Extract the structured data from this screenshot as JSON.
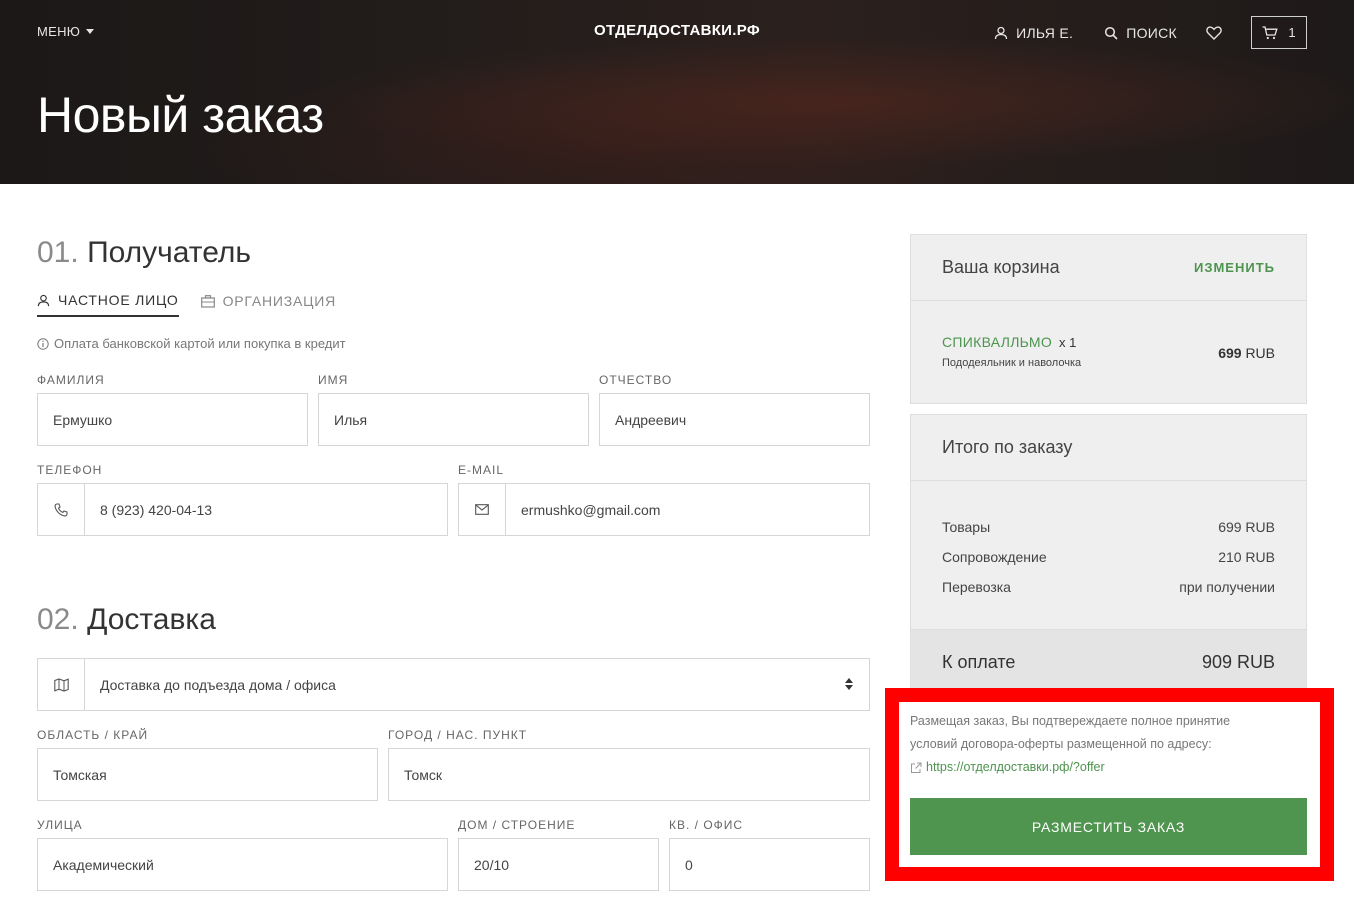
{
  "header": {
    "menu_label": "МЕНЮ",
    "brand": "ОТДЕЛДОСТАВКИ.РФ",
    "user_label": "ИЛЬЯ Е.",
    "search_label": "ПОИСК",
    "cart_count": "1",
    "page_title": "Новый заказ"
  },
  "recipient": {
    "num": "01.",
    "title": "Получатель",
    "tabs": [
      {
        "label": "ЧАСТНОЕ ЛИЦО",
        "active": true
      },
      {
        "label": "ОРГАНИЗАЦИЯ",
        "active": false
      }
    ],
    "note": "Оплата банковской картой или покупка в кредит",
    "last_name": {
      "label": "ФАМИЛИЯ",
      "value": "Ермушко"
    },
    "first_name": {
      "label": "ИМЯ",
      "value": "Илья"
    },
    "middle_name": {
      "label": "ОТЧЕСТВО",
      "value": "Андреевич"
    },
    "phone": {
      "label": "ТЕЛЕФОН",
      "value": "8 (923) 420-04-13"
    },
    "email": {
      "label": "E-MAIL",
      "value": "ermushko@gmail.com"
    }
  },
  "delivery": {
    "num": "02.",
    "title": "Доставка",
    "method": "Доставка до подъезда дома / офиса",
    "region": {
      "label": "ОБЛАСТЬ / КРАЙ",
      "value": "Томская"
    },
    "city": {
      "label": "ГОРОД / НАС. ПУНКТ",
      "value": "Томск"
    },
    "street": {
      "label": "УЛИЦА",
      "value": "Академический"
    },
    "house": {
      "label": "ДОМ / СТРОЕНИЕ",
      "value": "20/10"
    },
    "apartment": {
      "label": "КВ. / ОФИС",
      "value": "0"
    }
  },
  "cart": {
    "title": "Ваша корзина",
    "edit_label": "ИЗМЕНИТЬ",
    "item": {
      "name": "СПИКВАЛЛЬМО",
      "qty": "x  1",
      "description": "Пододеяльник и наволочка",
      "price_amount": "699",
      "price_currency": "RUB"
    }
  },
  "summary": {
    "title": "Итого по заказу",
    "rows": [
      {
        "label": "Товары",
        "value": "699 RUB"
      },
      {
        "label": "Сопровождение",
        "value": "210 RUB"
      },
      {
        "label": "Перевозка",
        "value": "при получении"
      }
    ],
    "total_label": "К оплате",
    "total_value": "909 RUB"
  },
  "checkout": {
    "terms_line1": "Размещая заказ, Вы подтвереждаете полное принятие",
    "terms_line2": "условий договора-оферты размещенной по адресу:",
    "terms_link": "https://отделдоставки.рф/?offer",
    "place_order_label": "РАЗМЕСТИТЬ ЗАКАЗ"
  },
  "colors": {
    "accent_green": "#4f944f",
    "highlight_red": "#ff0000"
  }
}
